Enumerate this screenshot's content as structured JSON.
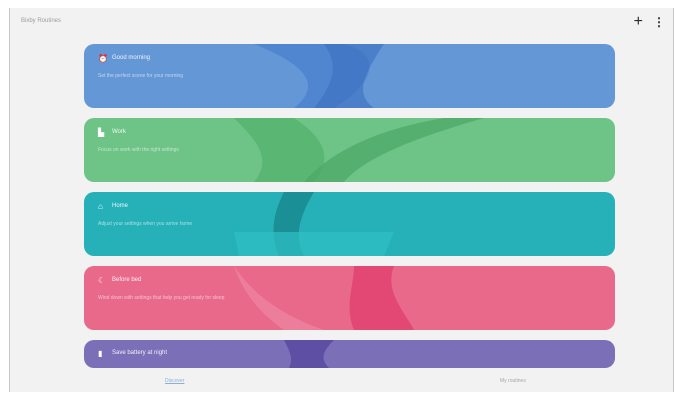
{
  "app": {
    "title": "Bixby Routines",
    "add_icon": "plus-icon",
    "more_icon": "more-vertical-icon"
  },
  "routines": [
    {
      "name": "Good morning",
      "desc": "Set the perfect scene for your morning",
      "icon": "alarm-clock-icon",
      "color": "#6497d6"
    },
    {
      "name": "Work",
      "desc": "Focus on work with the right settings",
      "icon": "building-icon",
      "color": "#6ec387"
    },
    {
      "name": "Home",
      "desc": "Adjust your settings when you arrive home",
      "icon": "home-icon",
      "color": "#26b1b8"
    },
    {
      "name": "Before bed",
      "desc": "Wind down with settings that help you get ready for sleep",
      "icon": "moon-icon",
      "color": "#e8698a"
    },
    {
      "name": "Save battery at night",
      "desc": "",
      "icon": "battery-icon",
      "color": "#7b6fb8"
    }
  ],
  "tabs": [
    {
      "label": "Discover",
      "active": true
    },
    {
      "label": "My routines",
      "active": false
    }
  ]
}
